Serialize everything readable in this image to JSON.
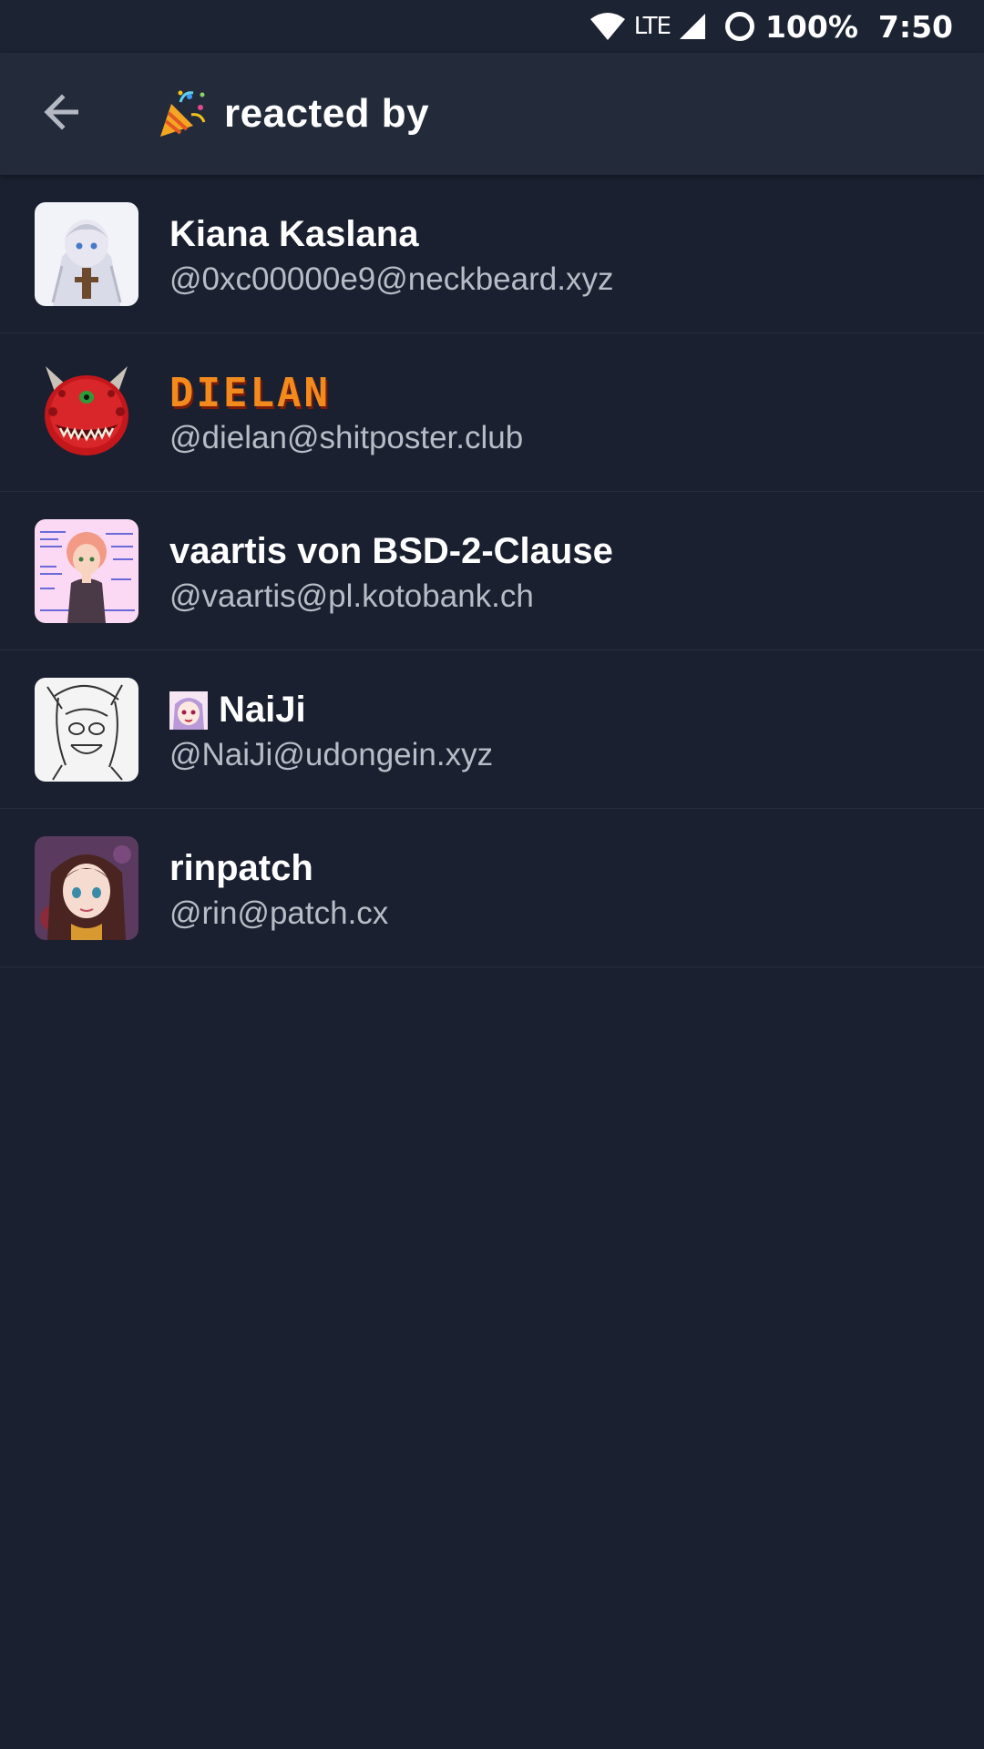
{
  "status_bar": {
    "network": "LTE",
    "battery": "100%",
    "time": "7:50",
    "icons": [
      "wifi-icon",
      "signal-icon",
      "battery-icon"
    ]
  },
  "header": {
    "back_icon": "arrow-left-icon",
    "title_icon": "party-popper-icon",
    "title": "reacted by"
  },
  "users": [
    {
      "display_name": "Kiana Kaslana",
      "handle": "@0xc00000e9@neckbeard.xyz"
    },
    {
      "display_name": "DIELAN",
      "handle": "@dielan@shitposter.club"
    },
    {
      "display_name": "vaartis von BSD-2-Clause",
      "handle": "@vaartis@pl.kotobank.ch"
    },
    {
      "display_name": "NaiJi",
      "handle": "@NaiJi@udongein.xyz"
    },
    {
      "display_name": "rinpatch",
      "handle": "@rin@patch.cx"
    }
  ],
  "colors": {
    "background": "#1a2030",
    "app_bar": "#232b3b",
    "text_primary": "#ffffff",
    "text_secondary": "#b8bcc6"
  }
}
